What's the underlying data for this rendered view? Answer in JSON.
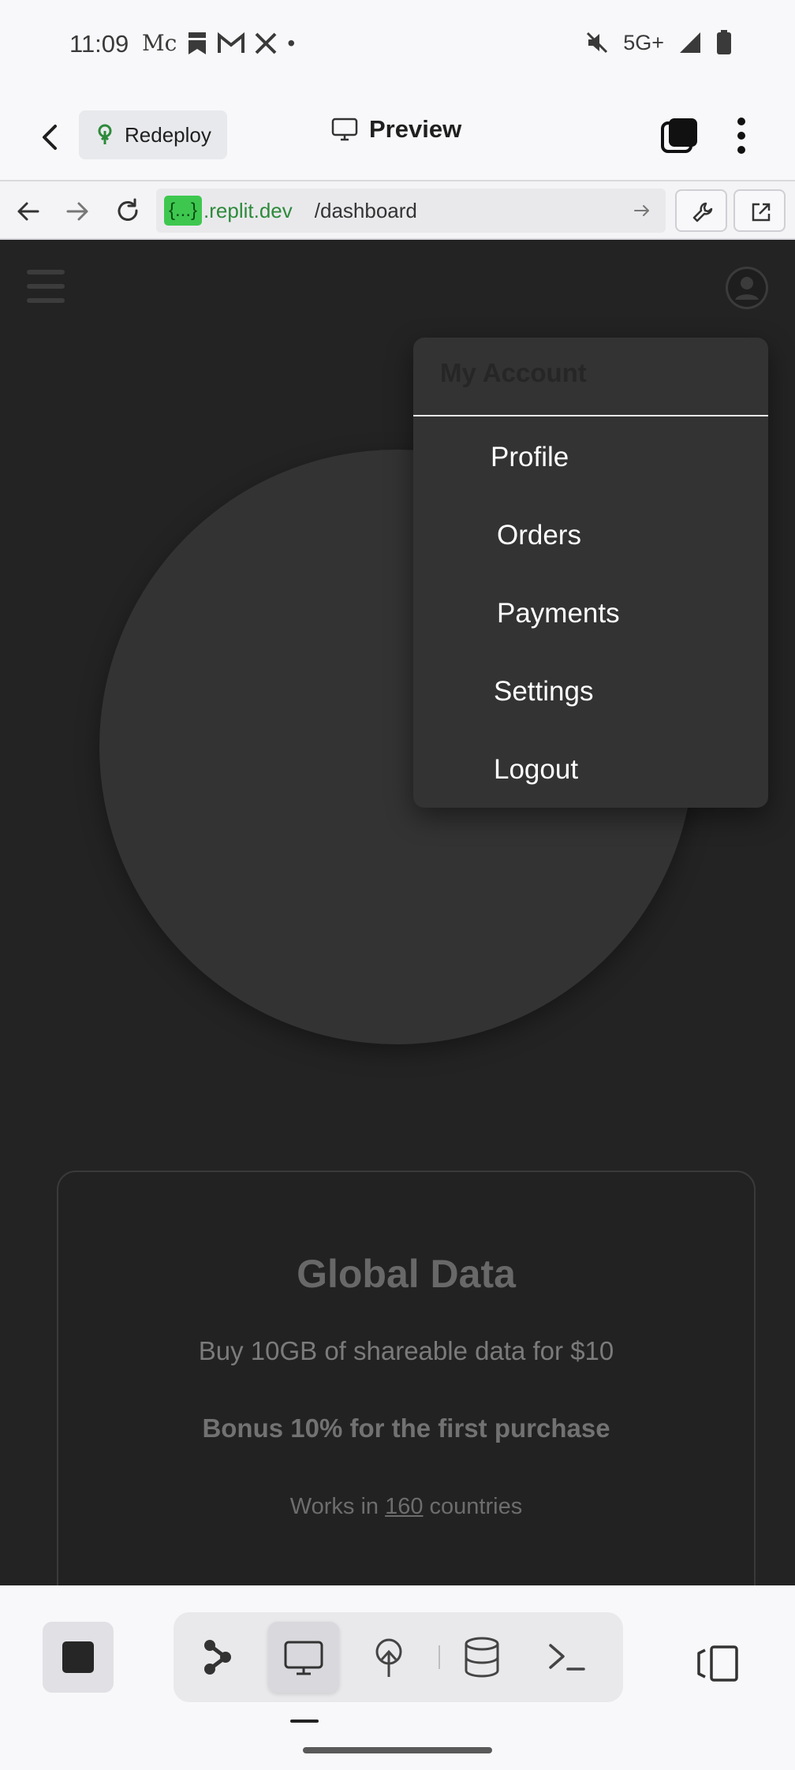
{
  "status_bar": {
    "time": "11:09",
    "notifications": [
      "Mc",
      "bookmark-icon",
      "gmail-icon",
      "x-icon",
      "•"
    ],
    "network": "5G+"
  },
  "app_header": {
    "redeploy_label": "Redeploy",
    "preview_label": "Preview"
  },
  "url_bar": {
    "badge": "{...}",
    "domain": ".replit.dev",
    "path": "/dashboard"
  },
  "menu": {
    "title": "My Account",
    "items": [
      "Profile",
      "Orders",
      "Payments",
      "Settings",
      "Logout"
    ]
  },
  "card": {
    "title": "Global Data",
    "subtitle": "Buy 10GB of shareable data for $10",
    "bonus": "Bonus 10% for the first purchase",
    "works_prefix": "Works in",
    "works_count": "160",
    "works_suffix": "countries"
  },
  "colors": {
    "page_bg": "#232323",
    "menu_bg": "#333333",
    "url_badge": "#3ec74f",
    "url_domain": "#2d8a3a"
  }
}
